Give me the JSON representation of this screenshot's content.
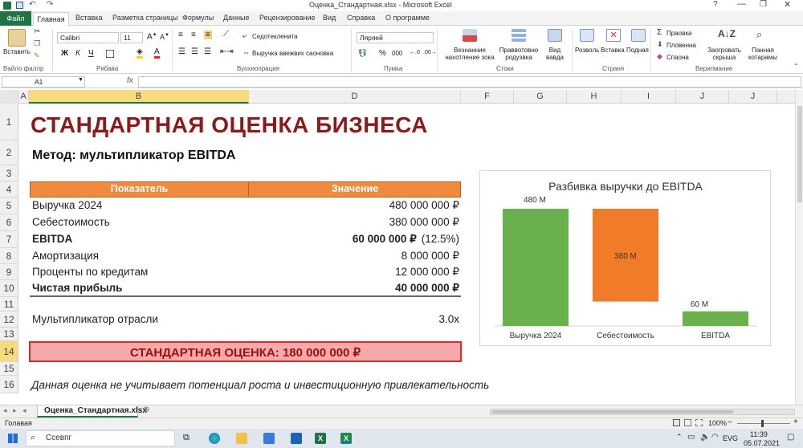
{
  "window": {
    "title": "Оценка_Стандартная.xlsx - Microsoft Excel"
  },
  "ribbon": {
    "file_tab": "Файл",
    "tabs": [
      "Главная",
      "Вставка",
      "Разметка страницы",
      "Формулы",
      "Данные",
      "Рецензирование",
      "Вид",
      "Справка",
      "О программе"
    ],
    "paste_label": "Вставить",
    "clipboard_group": "Вайло фаллр",
    "font_name": "Calibri",
    "font_size": "11",
    "font_group": "Рибава",
    "wrap_text": "Седотекленита",
    "merge_center": "Выручка ввежвих саоновка",
    "alignment_group": "Вуохнопрация",
    "number_format": "Ляряей",
    "number_group": "Пумка",
    "cond_format": "Везнанние нахотление зока",
    "format_table": "Праввотовно родузвка",
    "cell_styles": "Вид вавдa",
    "styles_group": "Стоки",
    "insert_btn": "Розволь",
    "delete_btn": "Вставка",
    "format_btn": "Подная",
    "cells_group": "Страня",
    "autosum": "Праовка",
    "fill": "Пловенна",
    "clear": "Спаона",
    "sort_filter": "Заогровать скрыша",
    "find_select": "Панная котарамы",
    "editing_group": "Верипмание"
  },
  "formula_bar": {
    "name_box": "A1",
    "fx": "fx",
    "content": ""
  },
  "columns": [
    "A",
    "B",
    "D",
    "F",
    "G",
    "H",
    "I",
    "J",
    "J"
  ],
  "rows": [
    "1",
    "2",
    "3",
    "4",
    "5",
    "6",
    "7",
    "8",
    "9",
    "10",
    "11",
    "12",
    "13",
    "14",
    "15",
    "16"
  ],
  "sheet": {
    "title": "СТАНДАРТНАЯ ОЦЕНКА БИЗНЕСА",
    "method": "Метод: мультипликатор EBITDA",
    "table_header": {
      "indicator": "Показатель",
      "value": "Значение"
    },
    "table_rows": [
      {
        "label": "Выручка 2024",
        "value": "480 000 000 ₽",
        "note": "",
        "bold": false
      },
      {
        "label": "Себестоимость",
        "value": "380 000 000 ₽",
        "note": "",
        "bold": false
      },
      {
        "label": "EBITDA",
        "value": "60 000 000 ₽",
        "note": "(12.5%)",
        "bold": true
      },
      {
        "label": "Амортизация",
        "value": "8 000 000 ₽",
        "note": "",
        "bold": false
      },
      {
        "label": "Проценты по кредитам",
        "value": "12 000 000 ₽",
        "note": "",
        "bold": false
      },
      {
        "label": "Чистая прибыль",
        "value": "40 000 000 ₽",
        "note": "",
        "bold": true
      }
    ],
    "multiplier_label": "Мультипликатор отрасли",
    "multiplier_value": "3.0x",
    "result": "СТАНДАРТНАЯ ОЦЕНКА: 180 000 000 ₽",
    "disclaimer": "Данная оценка не учитывает потенциал роста и инвестиционную привлекательность"
  },
  "chart_data": {
    "type": "bar",
    "title": "Разбивка выручки до EBITDA",
    "categories": [
      "Выручка 2024",
      "Себестоимость",
      "EBITDA"
    ],
    "values": [
      480,
      380,
      60
    ],
    "data_labels": [
      "480 M",
      "380 M",
      "60 M"
    ],
    "colors": [
      "#6ab04c",
      "#f07c2a",
      "#6ab04c"
    ],
    "bar_bases": [
      0,
      100,
      0
    ],
    "ylim": [
      0,
      480
    ],
    "grid": false,
    "legend": "none"
  },
  "sheet_tabs": {
    "active": "Оценка_Стандартная.xlsx"
  },
  "status": {
    "ready": "Голавая",
    "zoom": "100%"
  },
  "taskbar": {
    "search": "Ссевпг",
    "lang": "EVG",
    "time": "11:39",
    "date": "05.07.2021"
  },
  "colors": {
    "excel_green": "#217346",
    "header_orange": "#f08a3c",
    "title_red": "#8b1a1a",
    "result_fill": "#f4aaaa",
    "result_border": "#d92b2b"
  }
}
